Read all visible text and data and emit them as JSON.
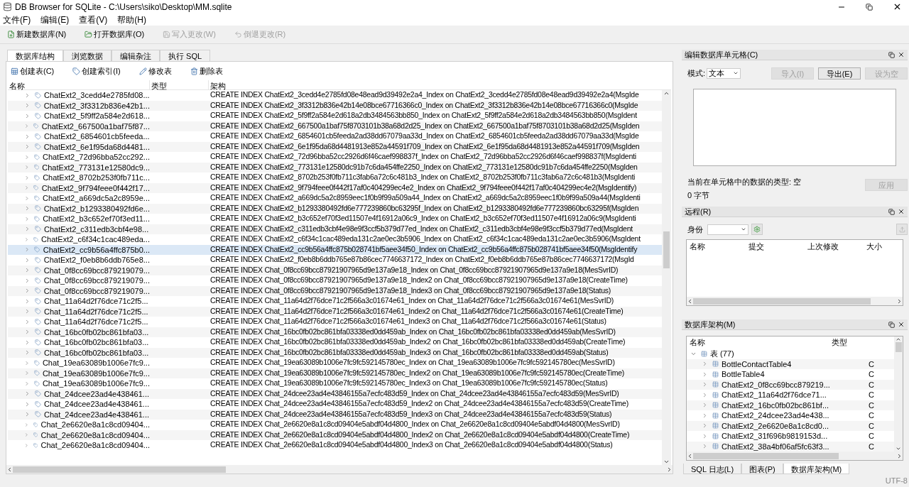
{
  "window": {
    "title": "DB Browser for SQLite - C:\\Users\\siko\\Desktop\\MM.sqlite"
  },
  "menu": [
    "文件(F)",
    "编辑(E)",
    "查看(V)",
    "帮助(H)"
  ],
  "toolbar": [
    {
      "label": "新建数据库(N)",
      "disabled": false
    },
    {
      "label": "打开数据库(O)",
      "disabled": false
    },
    {
      "label": "写入更改(W)",
      "disabled": true
    },
    {
      "label": "倒退更改(R)",
      "disabled": true
    }
  ],
  "tabs": [
    {
      "label": "数据库结构",
      "selected": true
    },
    {
      "label": "浏览数据",
      "selected": false
    },
    {
      "label": "编辑杂注",
      "selected": false
    },
    {
      "label": "执行 SQL",
      "selected": false
    }
  ],
  "structure": {
    "actions": [
      "创建表(C)",
      "创建索引(I)",
      "修改表",
      "删除表"
    ],
    "columns": [
      "名称",
      "类型",
      "架构"
    ],
    "rows": [
      {
        "name": "ChatExt2_3cedd4e2785fd08...",
        "schema": "CREATE INDEX ChatExt2_3cedd4e2785fd08e48ead9d39492e2a4_Index on ChatExt2_3cedd4e2785fd08e48ead9d39492e2a4(MsgIde",
        "selected": false
      },
      {
        "name": "ChatExt2_3f3312b836e42b1...",
        "schema": "CREATE INDEX ChatExt2_3f3312b836e42b14e08bce67716366c0_Index on ChatExt2_3f3312b836e42b14e08bce67716366c0(MsgIde",
        "selected": false
      },
      {
        "name": "ChatExt2_5f9ff2a584e2d618...",
        "schema": "CREATE INDEX ChatExt2_5f9ff2a584e2d618a2db3484563bb850_Index on ChatExt2_5f9ff2a584e2d618a2db3484563bb850(MsgIdent",
        "selected": false
      },
      {
        "name": "ChatExt2_667500a1baf75f87...",
        "schema": "CREATE INDEX ChatExt2_667500a1baf75f8703101b38a68d2d25_Index on ChatExt2_667500a1baf75f8703101b38a68d2d25(MsgIden",
        "selected": false
      },
      {
        "name": "ChatExt2_6854601cb5feeda...",
        "schema": "CREATE INDEX ChatExt2_6854601cb5feeda2ad38dd67079aa33d_Index on ChatExt2_6854601cb5feeda2ad38dd67079aa33d(MsgIde",
        "selected": false
      },
      {
        "name": "ChatExt2_6e1f95da68d4481...",
        "schema": "CREATE INDEX ChatExt2_6e1f95da68d4481913e852a44591f709_Index on ChatExt2_6e1f95da68d4481913e852a44591f709(MsgIden",
        "selected": false
      },
      {
        "name": "ChatExt2_72d96bba52cc292...",
        "schema": "CREATE INDEX ChatExt2_72d96bba52cc2926d6f46caef998837f_Index on ChatExt2_72d96bba52cc2926d6f46caef998837f(MsgIdenti",
        "selected": false
      },
      {
        "name": "ChatExt2_773131e12580dc9...",
        "schema": "CREATE INDEX ChatExt2_773131e12580dc91b7c6da454ffe2250_Index on ChatExt2_773131e12580dc91b7c6da454ffe2250(MsgIden",
        "selected": false
      },
      {
        "name": "ChatExt2_8702b253f0fb711c...",
        "schema": "CREATE INDEX ChatExt2_8702b253f0fb711c3fab6a72c6c481b3_Index on ChatExt2_8702b253f0fb711c3fab6a72c6c481b3(MsgIdenti",
        "selected": false
      },
      {
        "name": "ChatExt2_9f794feee0f442f17...",
        "schema": "CREATE INDEX ChatExt2_9f794feee0f442f17af0c404299ec4e2_Index on ChatExt2_9f794feee0f442f17af0c404299ec4e2(MsgIdentify)",
        "selected": false
      },
      {
        "name": "ChatExt2_a669dc5a2c8959e...",
        "schema": "CREATE INDEX ChatExt2_a669dc5a2c8959eec1f0b9f99a509a44_Index on ChatExt2_a669dc5a2c8959eec1f0b9f99a509a44(MsgIdenti",
        "selected": false
      },
      {
        "name": "ChatExt2_b1293380492fd6e...",
        "schema": "CREATE INDEX ChatExt2_b1293380492fd6e777239860bc63295f_Index on ChatExt2_b1293380492fd6e777239860bc63295f(MsgIden",
        "selected": false
      },
      {
        "name": "ChatExt2_b3c652ef70f3ed11...",
        "schema": "CREATE INDEX ChatExt2_b3c652ef70f3ed11507e4f16912a06c9_Index on ChatExt2_b3c652ef70f3ed11507e4f16912a06c9(MsgIdenti",
        "selected": false
      },
      {
        "name": "ChatExt2_c311edb3cbf4e98...",
        "schema": "CREATE INDEX ChatExt2_c311edb3cbf4e98e9f3ccf5b379d77ed_Index on ChatExt2_c311edb3cbf4e98e9f3ccf5b379d77ed(MsgIdent",
        "selected": false
      },
      {
        "name": "ChatExt2_c6f34c1cac489eda...",
        "schema": "CREATE INDEX ChatExt2_c6f34c1cac489eda131c2ae0ec3b5906_Index on ChatExt2_c6f34c1cac489eda131c2ae0ec3b5906(MsgIdent",
        "selected": false
      },
      {
        "name": "ChatExt2_cc9b56a4ffc875b0...",
        "schema": "CREATE INDEX ChatExt2_cc9b56a4ffc875b028741bf5aee34f50_Index on ChatExt2_cc9b56a4ffc875b028741bf5aee34f50(MsgIdentify",
        "selected": true
      },
      {
        "name": "ChatExt2_f0eb8b6ddb765e8...",
        "schema": "CREATE INDEX ChatExt2_f0eb8b6ddb765e87b86cec7746637172_Index on ChatExt2_f0eb8b6ddb765e87b86cec7746637172(MsgId",
        "selected": false
      },
      {
        "name": "Chat_0f8cc69bcc879219079...",
        "schema": "CREATE INDEX Chat_0f8cc69bcc87921907965d9e137a9e18_Index on Chat_0f8cc69bcc87921907965d9e137a9e18(MesSvrID)",
        "selected": false
      },
      {
        "name": "Chat_0f8cc69bcc879219079...",
        "schema": "CREATE INDEX Chat_0f8cc69bcc87921907965d9e137a9e18_Index2 on Chat_0f8cc69bcc87921907965d9e137a9e18(CreateTime)",
        "selected": false
      },
      {
        "name": "Chat_0f8cc69bcc879219079...",
        "schema": "CREATE INDEX Chat_0f8cc69bcc87921907965d9e137a9e18_Index3 on Chat_0f8cc69bcc87921907965d9e137a9e18(Status)",
        "selected": false
      },
      {
        "name": "Chat_11a64d2f76dce71c2f5...",
        "schema": "CREATE INDEX Chat_11a64d2f76dce71c2f566a3c01674e61_Index on Chat_11a64d2f76dce71c2f566a3c01674e61(MesSvrID)",
        "selected": false
      },
      {
        "name": "Chat_11a64d2f76dce71c2f5...",
        "schema": "CREATE INDEX Chat_11a64d2f76dce71c2f566a3c01674e61_Index2 on Chat_11a64d2f76dce71c2f566a3c01674e61(CreateTime)",
        "selected": false
      },
      {
        "name": "Chat_11a64d2f76dce71c2f5...",
        "schema": "CREATE INDEX Chat_11a64d2f76dce71c2f566a3c01674e61_Index3 on Chat_11a64d2f76dce71c2f566a3c01674e61(Status)",
        "selected": false
      },
      {
        "name": "Chat_16bc0fb02bc861bfa03...",
        "schema": "CREATE INDEX Chat_16bc0fb02bc861bfa03338ed0dd459ab_Index on Chat_16bc0fb02bc861bfa03338ed0dd459ab(MesSvrID)",
        "selected": false
      },
      {
        "name": "Chat_16bc0fb02bc861bfa03...",
        "schema": "CREATE INDEX Chat_16bc0fb02bc861bfa03338ed0dd459ab_Index2 on Chat_16bc0fb02bc861bfa03338ed0dd459ab(CreateTime)",
        "selected": false
      },
      {
        "name": "Chat_16bc0fb02bc861bfa03...",
        "schema": "CREATE INDEX Chat_16bc0fb02bc861bfa03338ed0dd459ab_Index3 on Chat_16bc0fb02bc861bfa03338ed0dd459ab(Status)",
        "selected": false
      },
      {
        "name": "Chat_19ea63089b1006e7fc9...",
        "schema": "CREATE INDEX Chat_19ea63089b1006e7fc9fc592145780ec_Index on Chat_19ea63089b1006e7fc9fc592145780ec(MesSvrID)",
        "selected": false
      },
      {
        "name": "Chat_19ea63089b1006e7fc9...",
        "schema": "CREATE INDEX Chat_19ea63089b1006e7fc9fc592145780ec_Index2 on Chat_19ea63089b1006e7fc9fc592145780ec(CreateTime)",
        "selected": false
      },
      {
        "name": "Chat_19ea63089b1006e7fc9...",
        "schema": "CREATE INDEX Chat_19ea63089b1006e7fc9fc592145780ec_Index3 on Chat_19ea63089b1006e7fc9fc592145780ec(Status)",
        "selected": false
      },
      {
        "name": "Chat_24dcee23ad4e438461...",
        "schema": "CREATE INDEX Chat_24dcee23ad4e43846155a7ecfc483d59_Index on Chat_24dcee23ad4e43846155a7ecfc483d59(MesSvrID)",
        "selected": false
      },
      {
        "name": "Chat_24dcee23ad4e438461...",
        "schema": "CREATE INDEX Chat_24dcee23ad4e43846155a7ecfc483d59_Index2 on Chat_24dcee23ad4e43846155a7ecfc483d59(CreateTime)",
        "selected": false
      },
      {
        "name": "Chat_24dcee23ad4e438461...",
        "schema": "CREATE INDEX Chat_24dcee23ad4e43846155a7ecfc483d59_Index3 on Chat_24dcee23ad4e43846155a7ecfc483d59(Status)",
        "selected": false
      },
      {
        "name": "Chat_2e6620e8a1c8cd09404...",
        "schema": "CREATE INDEX Chat_2e6620e8a1c8cd09404e5abdf04d4800_Index on Chat_2e6620e8a1c8cd09404e5abdf04d4800(MesSvrID)",
        "selected": false
      },
      {
        "name": "Chat_2e6620e8a1c8cd09404...",
        "schema": "CREATE INDEX Chat_2e6620e8a1c8cd09404e5abdf04d4800_Index2 on Chat_2e6620e8a1c8cd09404e5abdf04d4800(CreateTime)",
        "selected": false
      },
      {
        "name": "Chat_2e6620e8a1c8cd09404...",
        "schema": "CREATE INDEX Chat_2e6620e8a1c8cd09404e5abdf04d4800_Index3 on Chat_2e6620e8a1c8cd09404e5abdf04d4800(Status)",
        "selected": false
      }
    ]
  },
  "cell_editor": {
    "title": "编辑数据库单元格(C)",
    "mode_label": "模式:",
    "mode": "文本",
    "buttons": [
      {
        "label": "导入(I)",
        "disabled": true
      },
      {
        "label": "导出(E)",
        "disabled": false
      },
      {
        "label": "设为空",
        "disabled": true
      }
    ],
    "type_info": "当前在单元格中的数据的类型: 空",
    "size": "0 字节",
    "apply": {
      "label": "应用",
      "disabled": true
    }
  },
  "remote": {
    "title": "远程(R)",
    "identity_label": "身份",
    "columns": [
      "名称",
      "提交",
      "上次修改",
      "大小"
    ]
  },
  "schema_panel": {
    "title": "数据库架构(M)",
    "columns": [
      "名称",
      "类型"
    ],
    "tree": [
      {
        "name": "表 (77)",
        "expanded": true,
        "children": [
          {
            "name": "BottleContactTable4",
            "schema": "C"
          },
          {
            "name": "BottleTable4",
            "schema": "C"
          },
          {
            "name": "ChatExt2_0f8cc69bcc879219...",
            "schema": "C"
          },
          {
            "name": "ChatExt2_11a64d2f76dce71...",
            "schema": "C"
          },
          {
            "name": "ChatExt2_16bc0fb02bc861bf...",
            "schema": "C"
          },
          {
            "name": "ChatExt2_24dcee23ad4e438...",
            "schema": "C"
          },
          {
            "name": "ChatExt2_2e6620e8a1c8cd0...",
            "schema": "C"
          },
          {
            "name": "ChatExt2_31f696b9819153d...",
            "schema": "C"
          },
          {
            "name": "ChatExt2_38a4bf06af5fc63f3...",
            "schema": "C"
          }
        ]
      }
    ]
  },
  "bottom_tabs": [
    {
      "label": "SQL 日志(L)",
      "selected": false
    },
    {
      "label": "图表(P)",
      "selected": false
    },
    {
      "label": "数据库架构(M)",
      "selected": true
    }
  ],
  "status_bar": {
    "encoding": "UTF-8"
  }
}
